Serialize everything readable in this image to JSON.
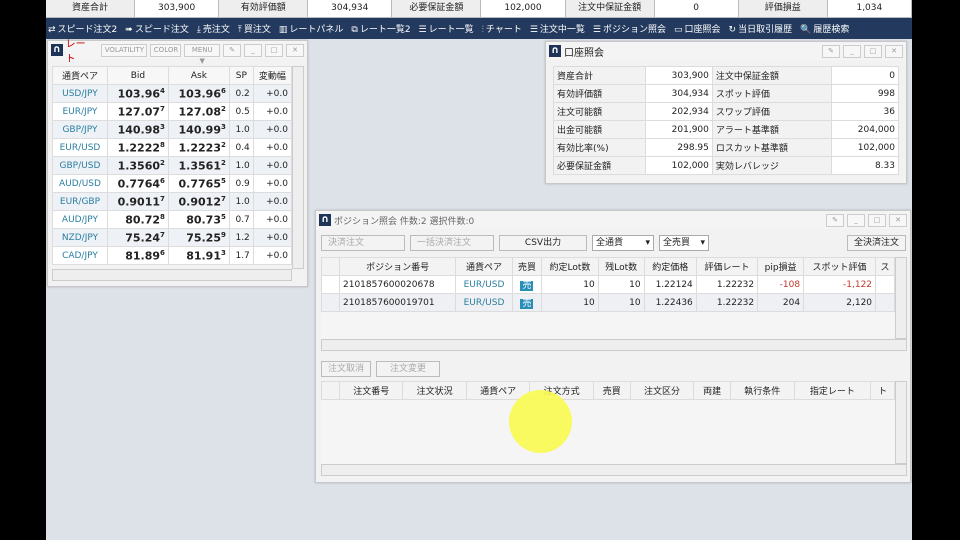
{
  "summary": [
    [
      "資産合計",
      "303,900"
    ],
    [
      "有効評価額",
      "304,934"
    ],
    [
      "必要保証金額",
      "102,000"
    ],
    [
      "注文中保証金額",
      "0"
    ],
    [
      "評価損益",
      "1,034"
    ]
  ],
  "nav": [
    "スピード注文2",
    "スピード注文",
    "売注文",
    "買注文",
    "レートパネル",
    "レート一覧2",
    "レート一覧",
    "チャート",
    "注文中一覧",
    "ポジション照会",
    "口座照会",
    "当日取引履歴",
    "履歴検索"
  ],
  "rate": {
    "title": "レート",
    "buttons": [
      "VOLATILITY",
      "COLOR",
      "MENU ▼"
    ],
    "headers": [
      "通貨ペア",
      "Bid",
      "Ask",
      "SP",
      "変動幅"
    ],
    "rows": [
      [
        "USD/JPY",
        "103.96",
        "4",
        "103.96",
        "6",
        "0.2",
        "+0.0"
      ],
      [
        "EUR/JPY",
        "127.07",
        "7",
        "127.08",
        "2",
        "0.5",
        "+0.0"
      ],
      [
        "GBP/JPY",
        "140.98",
        "3",
        "140.99",
        "3",
        "1.0",
        "+0.0"
      ],
      [
        "EUR/USD",
        "1.2222",
        "8",
        "1.2223",
        "2",
        "0.4",
        "+0.0"
      ],
      [
        "GBP/USD",
        "1.3560",
        "2",
        "1.3561",
        "2",
        "1.0",
        "+0.0"
      ],
      [
        "AUD/USD",
        "0.7764",
        "6",
        "0.7765",
        "5",
        "0.9",
        "+0.0"
      ],
      [
        "EUR/GBP",
        "0.9011",
        "7",
        "0.9012",
        "7",
        "1.0",
        "+0.0"
      ],
      [
        "AUD/JPY",
        "80.72",
        "8",
        "80.73",
        "5",
        "0.7",
        "+0.0"
      ],
      [
        "NZD/JPY",
        "75.24",
        "7",
        "75.25",
        "9",
        "1.2",
        "+0.0"
      ],
      [
        "CAD/JPY",
        "81.89",
        "6",
        "81.91",
        "3",
        "1.7",
        "+0.0"
      ]
    ]
  },
  "account": {
    "title": "口座照会",
    "rows": [
      [
        "資産合計",
        "303,900",
        "注文中保証金額",
        "0"
      ],
      [
        "有効評価額",
        "304,934",
        "スポット評価",
        "998"
      ],
      [
        "注文可能額",
        "202,934",
        "スワップ評価",
        "36"
      ],
      [
        "出金可能額",
        "201,900",
        "アラート基準額",
        "204,000"
      ],
      [
        "有効比率(%)",
        "298.95",
        "ロスカット基準額",
        "102,000"
      ],
      [
        "必要保証金額",
        "102,000",
        "実効レバレッジ",
        "8.33"
      ]
    ]
  },
  "position": {
    "title": "ポジション照会 件数:2 選択件数:0",
    "toolbar": {
      "close": "決済注文",
      "bulk": "一括決済注文",
      "csv": "CSV出力",
      "currency": "全通貨",
      "side": "全売買",
      "all_close": "全決済注文"
    },
    "headers": [
      "ポジション番号",
      "通貨ペア",
      "売買",
      "約定Lot数",
      "残Lot数",
      "約定価格",
      "評価レート",
      "pip損益",
      "スポット評価",
      "ス"
    ],
    "rows": [
      [
        "2101857600020678",
        "EUR/USD",
        "売",
        "10",
        "10",
        "1.22124",
        "1.22232",
        "-108",
        "-1,122"
      ],
      [
        "2101857600019701",
        "EUR/USD",
        "売",
        "10",
        "10",
        "1.22436",
        "1.22232",
        "204",
        "2,120"
      ]
    ],
    "negative_color": "#c0392b"
  },
  "orders": {
    "toolbar": {
      "cancel": "注文取消",
      "modify": "注文変更"
    },
    "headers": [
      "注文番号",
      "注文状況",
      "通貨ペア",
      "注文方式",
      "売買",
      "注文区分",
      "両建",
      "執行条件",
      "指定レート",
      "ト"
    ]
  }
}
